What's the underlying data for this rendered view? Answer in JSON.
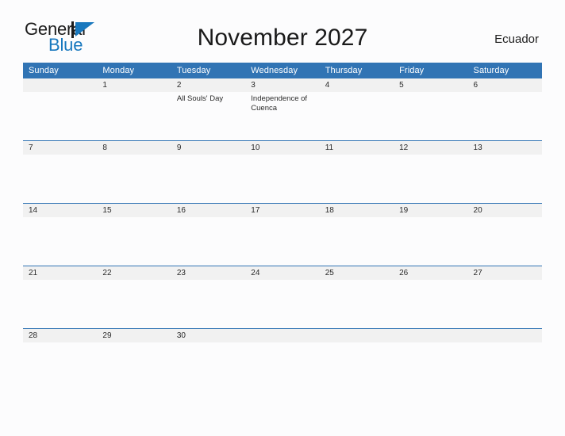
{
  "branding": {
    "logo_primary": "General",
    "logo_secondary": "Blue",
    "logo_flag_icon": "flag-triangle-icon",
    "primary_color": "#1878be",
    "header_color": "#3174b4",
    "band_color": "#f1f1f1"
  },
  "header": {
    "title": "November 2027",
    "country": "Ecuador"
  },
  "calendar": {
    "month": "November",
    "year": "2027",
    "weekday_headers": [
      "Sunday",
      "Monday",
      "Tuesday",
      "Wednesday",
      "Thursday",
      "Friday",
      "Saturday"
    ],
    "weeks": [
      [
        {
          "day": "",
          "events": []
        },
        {
          "day": "1",
          "events": []
        },
        {
          "day": "2",
          "events": [
            "All Souls' Day"
          ]
        },
        {
          "day": "3",
          "events": [
            "Independence of Cuenca"
          ]
        },
        {
          "day": "4",
          "events": []
        },
        {
          "day": "5",
          "events": []
        },
        {
          "day": "6",
          "events": []
        }
      ],
      [
        {
          "day": "7",
          "events": []
        },
        {
          "day": "8",
          "events": []
        },
        {
          "day": "9",
          "events": []
        },
        {
          "day": "10",
          "events": []
        },
        {
          "day": "11",
          "events": []
        },
        {
          "day": "12",
          "events": []
        },
        {
          "day": "13",
          "events": []
        }
      ],
      [
        {
          "day": "14",
          "events": []
        },
        {
          "day": "15",
          "events": []
        },
        {
          "day": "16",
          "events": []
        },
        {
          "day": "17",
          "events": []
        },
        {
          "day": "18",
          "events": []
        },
        {
          "day": "19",
          "events": []
        },
        {
          "day": "20",
          "events": []
        }
      ],
      [
        {
          "day": "21",
          "events": []
        },
        {
          "day": "22",
          "events": []
        },
        {
          "day": "23",
          "events": []
        },
        {
          "day": "24",
          "events": []
        },
        {
          "day": "25",
          "events": []
        },
        {
          "day": "26",
          "events": []
        },
        {
          "day": "27",
          "events": []
        }
      ],
      [
        {
          "day": "28",
          "events": []
        },
        {
          "day": "29",
          "events": []
        },
        {
          "day": "30",
          "events": []
        },
        {
          "day": "",
          "events": []
        },
        {
          "day": "",
          "events": []
        },
        {
          "day": "",
          "events": []
        },
        {
          "day": "",
          "events": []
        }
      ]
    ]
  }
}
